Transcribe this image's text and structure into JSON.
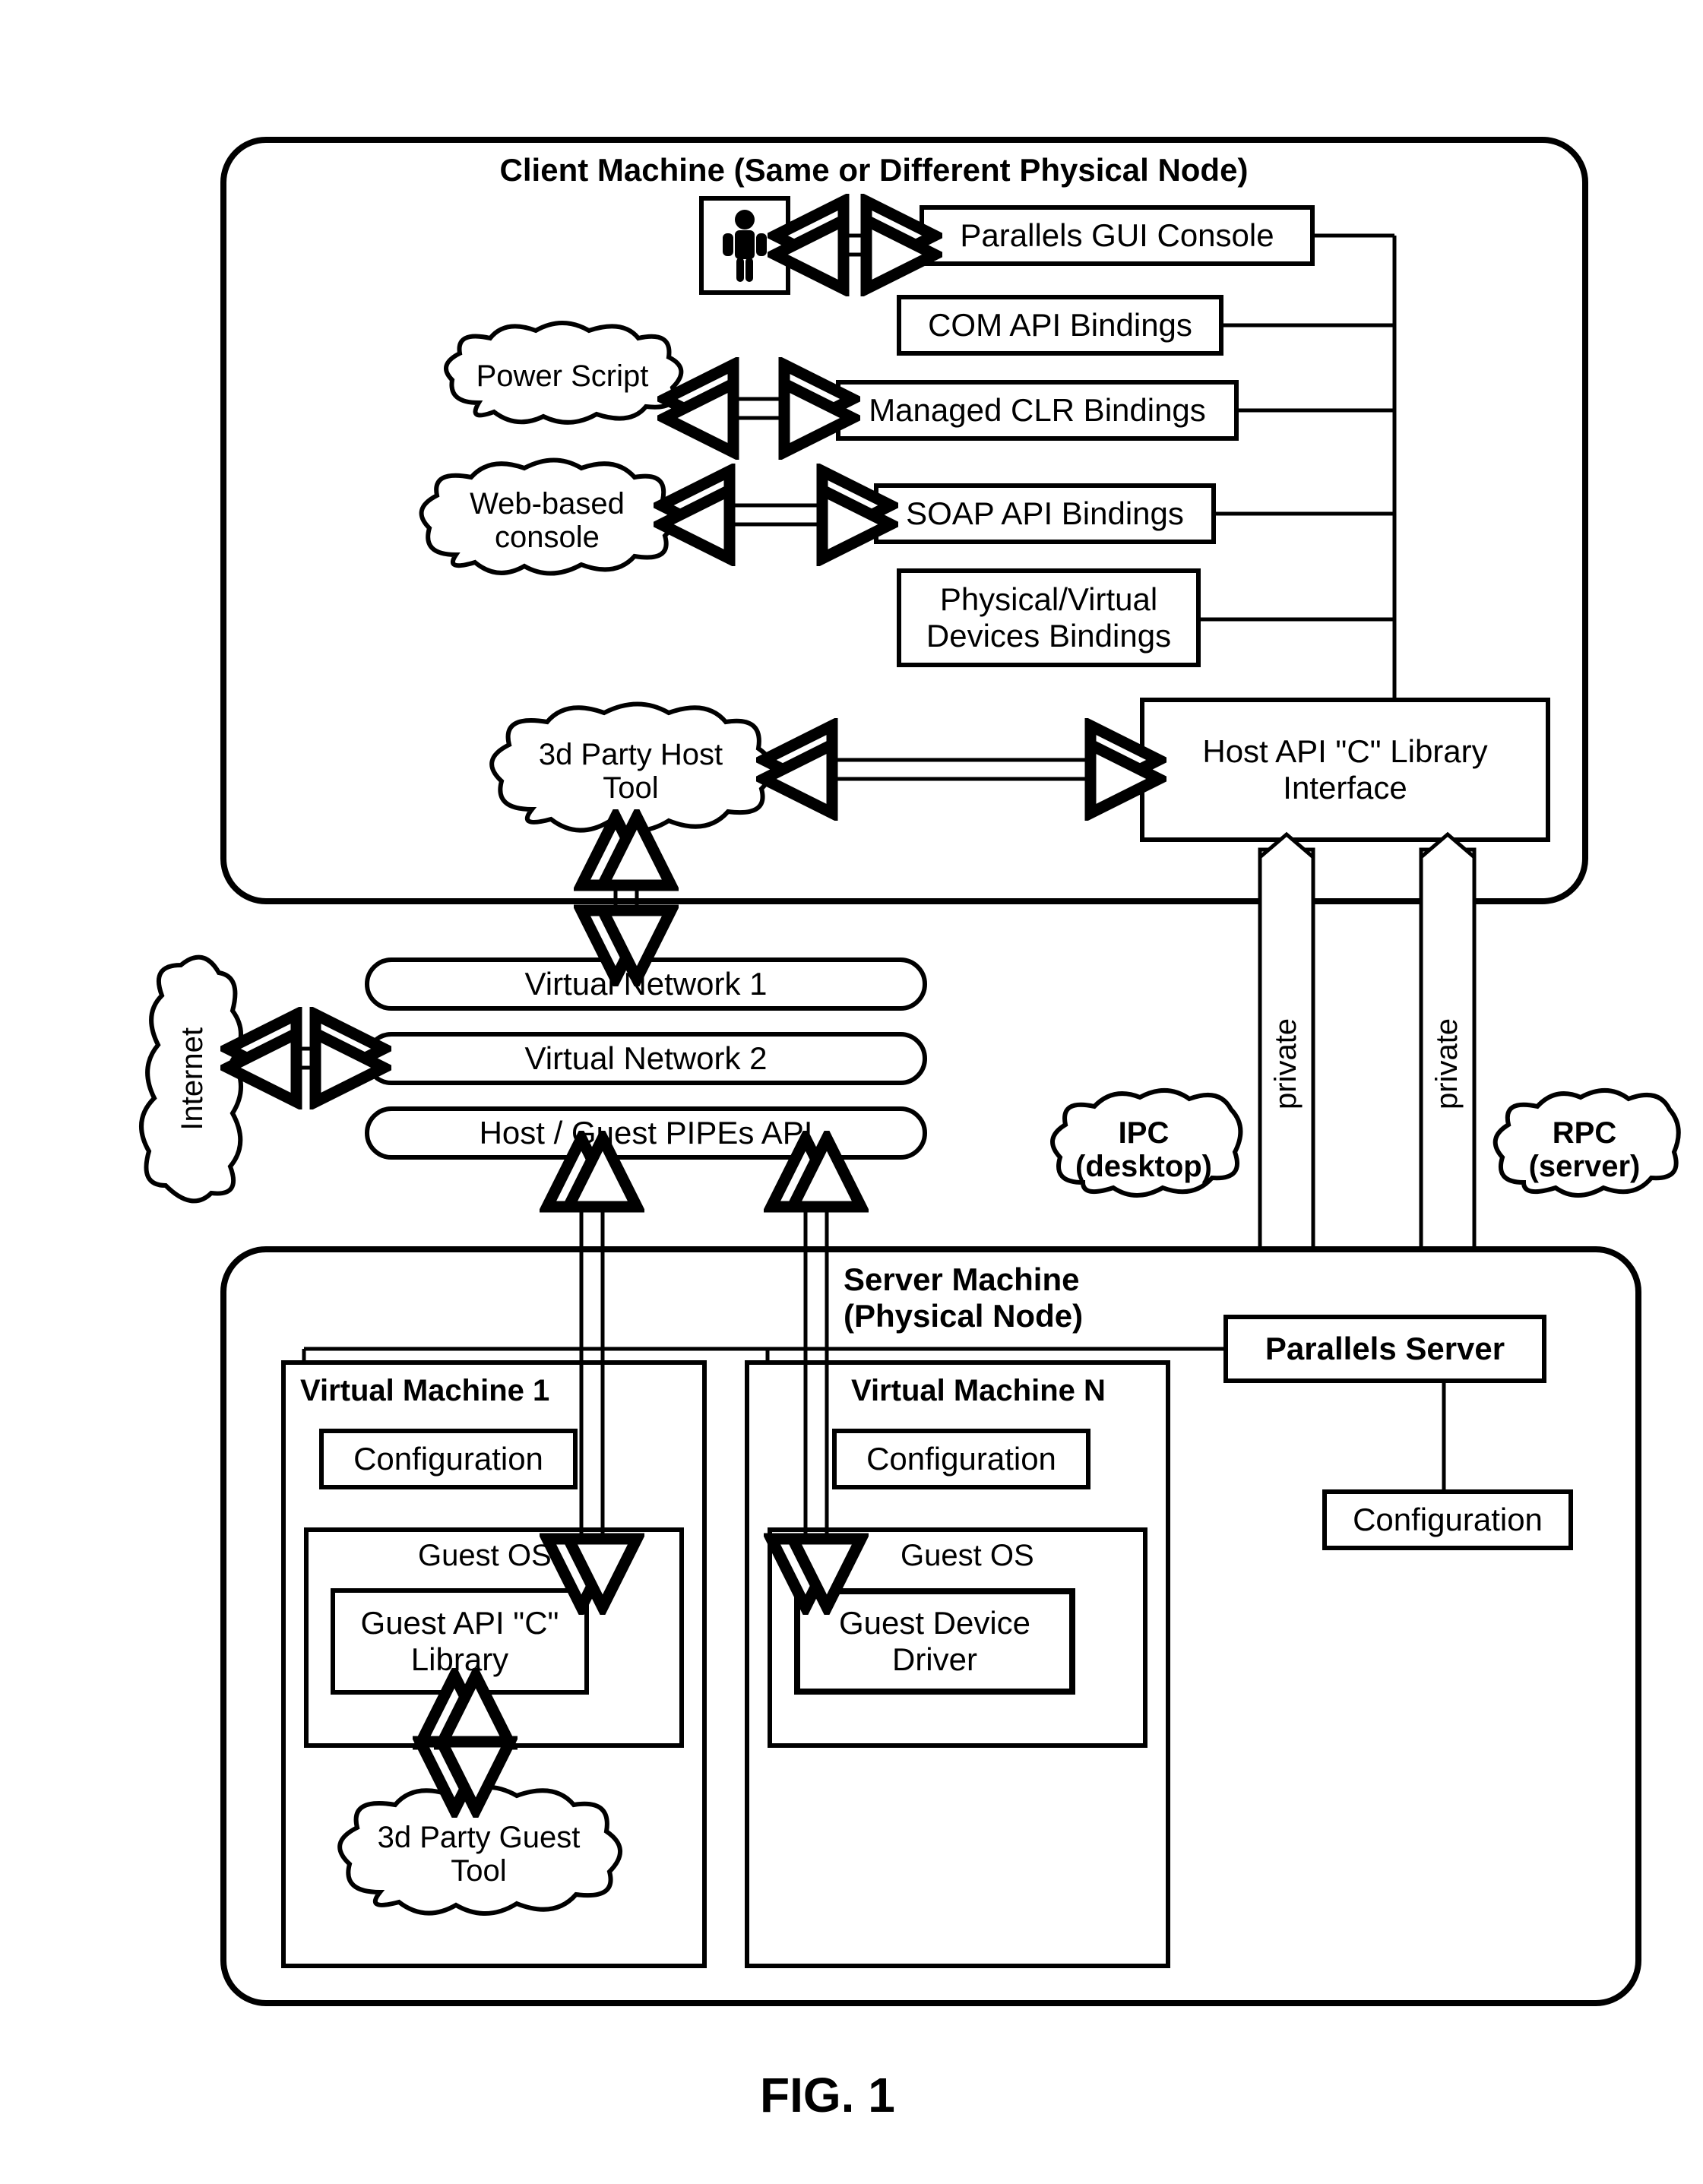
{
  "figure_caption": "FIG. 1",
  "client_panel": {
    "title": "Client Machine (Same or Different Physical Node)",
    "gui_console": "Parallels GUI Console",
    "com_bindings": "COM API Bindings",
    "clr_bindings": "Managed CLR Bindings",
    "soap_bindings": "SOAP API Bindings",
    "pv_bindings": "Physical/Virtual\nDevices Bindings",
    "host_api": "Host API \"C\" Library\nInterface",
    "power_script": "Power Script",
    "web_console": "Web-based\nconsole",
    "third_party_host": "3d Party Host\nTool"
  },
  "middle": {
    "vnet1": "Virtual Network 1",
    "vnet2": "Virtual Network 2",
    "pipes": "Host / Guest PIPEs API",
    "internet": "Internet",
    "ipc": "IPC\n(desktop)",
    "rpc": "RPC\n(server)",
    "private1": "private",
    "private2": "private"
  },
  "server_panel": {
    "title": "Server Machine\n(Physical Node)",
    "parallels_server": "Parallels Server",
    "server_config": "Configuration",
    "vm1": {
      "title": "Virtual Machine   1",
      "config": "Configuration",
      "guest_os": "Guest OS",
      "api_lib": "Guest API \"C\"\nLibrary",
      "third_party_guest": "3d Party Guest\nTool"
    },
    "vmN": {
      "title": "Virtual Machine N",
      "config": "Configuration",
      "guest_os": "Guest OS",
      "device_driver": "Guest Device\nDriver"
    }
  },
  "chart_data": {
    "type": "diagram",
    "note": "Architecture block diagram — no numeric data series.",
    "blocks": [
      "Client Machine (Same or Different Physical Node)",
      "Parallels GUI Console",
      "COM API Bindings",
      "Managed CLR Bindings",
      "SOAP API Bindings",
      "Physical/Virtual Devices Bindings",
      "Host API \"C\" Library Interface",
      "Power Script",
      "Web-based console",
      "3d Party Host Tool",
      "Virtual Network 1",
      "Virtual Network 2",
      "Host / Guest PIPEs API",
      "Internet",
      "IPC (desktop)",
      "RPC (server)",
      "Server Machine (Physical Node)",
      "Parallels Server",
      "Configuration (server)",
      "Virtual Machine 1",
      "Virtual Machine N",
      "Guest OS (VM1)",
      "Guest API \"C\" Library",
      "3d Party Guest Tool",
      "Guest OS (VM N)",
      "Guest Device Driver"
    ],
    "edges": [
      {
        "from": "User",
        "to": "Parallels GUI Console",
        "kind": "bidirectional"
      },
      {
        "from": "Parallels GUI Console",
        "to": "Host API \"C\" Library Interface",
        "kind": "line"
      },
      {
        "from": "COM API Bindings",
        "to": "Host API \"C\" Library Interface",
        "kind": "line"
      },
      {
        "from": "Managed CLR Bindings",
        "to": "Host API \"C\" Library Interface",
        "kind": "line"
      },
      {
        "from": "Power Script",
        "to": "Managed CLR Bindings",
        "kind": "bidirectional"
      },
      {
        "from": "SOAP API Bindings",
        "to": "Host API \"C\" Library Interface",
        "kind": "line"
      },
      {
        "from": "Web-based console",
        "to": "SOAP API Bindings",
        "kind": "bidirectional"
      },
      {
        "from": "Physical/Virtual Devices Bindings",
        "to": "Host API \"C\" Library Interface",
        "kind": "line"
      },
      {
        "from": "3d Party Host Tool",
        "to": "Host API \"C\" Library Interface",
        "kind": "bidirectional"
      },
      {
        "from": "3d Party Host Tool",
        "to": "Virtual Network 1",
        "kind": "bidirectional-vertical"
      },
      {
        "from": "Internet",
        "to": "Virtual Network 2",
        "kind": "bidirectional"
      },
      {
        "from": "Host API \"C\" Library Interface",
        "to": "Parallels Server",
        "kind": "bidirectional-vertical",
        "label": "private (IPC desktop)"
      },
      {
        "from": "Host API \"C\" Library Interface",
        "to": "Parallels Server",
        "kind": "bidirectional-vertical",
        "label": "private (RPC server)"
      },
      {
        "from": "Host / Guest PIPEs API",
        "to": "Guest API \"C\" Library (VM1)",
        "kind": "bidirectional-vertical"
      },
      {
        "from": "Host / Guest PIPEs API",
        "to": "Guest Device Driver (VM N)",
        "kind": "bidirectional-vertical"
      },
      {
        "from": "Guest API \"C\" Library",
        "to": "3d Party Guest Tool",
        "kind": "bidirectional-vertical"
      },
      {
        "from": "Parallels Server",
        "to": "Virtual Machine 1",
        "kind": "line"
      },
      {
        "from": "Parallels Server",
        "to": "Virtual Machine N",
        "kind": "line"
      },
      {
        "from": "Parallels Server",
        "to": "Configuration (server)",
        "kind": "line"
      }
    ]
  }
}
